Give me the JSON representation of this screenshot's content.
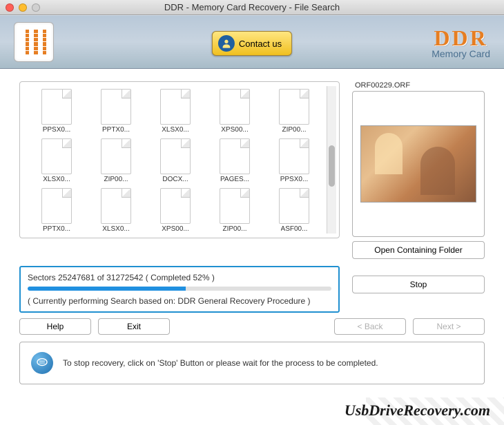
{
  "window": {
    "title": "DDR - Memory Card Recovery - File Search"
  },
  "header": {
    "contact_label": "Contact us",
    "brand_main": "DDR",
    "brand_sub": "Memory Card"
  },
  "files": [
    {
      "name": "PPSX0..."
    },
    {
      "name": "PPTX0..."
    },
    {
      "name": "XLSX0..."
    },
    {
      "name": "XPS00..."
    },
    {
      "name": "ZIP00..."
    },
    {
      "name": "XLSX0..."
    },
    {
      "name": "ZIP00..."
    },
    {
      "name": "DOCX..."
    },
    {
      "name": "PAGES..."
    },
    {
      "name": "PPSX0..."
    },
    {
      "name": "PPTX0..."
    },
    {
      "name": "XLSX0..."
    },
    {
      "name": "XPS00..."
    },
    {
      "name": "ZIP00..."
    },
    {
      "name": "ASF00..."
    }
  ],
  "preview": {
    "filename": "ORF00229.ORF",
    "open_folder_label": "Open Containing Folder"
  },
  "progress": {
    "sectors_line": "Sectors 25247681 of 31272542    ( Completed 52% )",
    "current_sector": 25247681,
    "total_sectors": 31272542,
    "percent": 52,
    "procedure_line": "( Currently performing Search based on: DDR General Recovery Procedure )",
    "stop_label": "Stop"
  },
  "buttons": {
    "help": "Help",
    "exit": "Exit",
    "back": "< Back",
    "next": "Next >"
  },
  "hint": {
    "text": "To stop recovery, click on 'Stop' Button or please wait for the process to be completed."
  },
  "footer": {
    "brand": "UsbDriveRecovery.com"
  }
}
